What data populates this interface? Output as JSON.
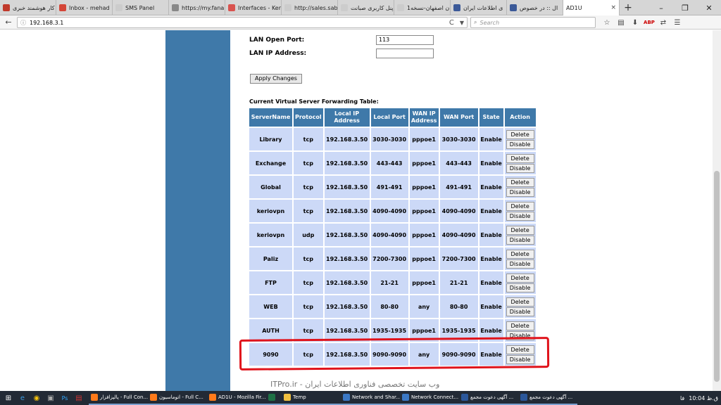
{
  "browser": {
    "tabs": [
      {
        "label": "کار هوشمند خبری",
        "icon_color": "#c0392b"
      },
      {
        "label": "Inbox - mehad",
        "icon_color": "#d44638"
      },
      {
        "label": "SMS Panel",
        "icon_color": "#cccccc"
      },
      {
        "label": "https://my.fana",
        "icon_color": "#888888"
      },
      {
        "label": "Interfaces - Ker",
        "icon_color": "#d9534f"
      },
      {
        "label": "http://sales.saban",
        "icon_color": "#cccccc"
      },
      {
        "label": "پنل کاربری صبانت",
        "icon_color": "#cccccc"
      },
      {
        "label": "ستان اصفهان-نسخه1",
        "icon_color": "#cccccc"
      },
      {
        "label": "ی اطلاعات ایران",
        "icon_color": "#3b5998"
      },
      {
        "label": "ال :: در خصوص",
        "icon_color": "#3b5998"
      }
    ],
    "active_tab": {
      "label": "AD1U",
      "close": "×"
    },
    "new_tab": "+",
    "window_controls": [
      "–",
      "❐",
      "✕"
    ],
    "url": "192.168.3.1",
    "search_placeholder": "Search",
    "back_icon": "←",
    "info_icon": "ⓘ",
    "reload_icon": "C",
    "dropdown_icon": "▼",
    "nav_icons": [
      "☆",
      "▤",
      "⬇",
      "ABP",
      "⇄",
      "☰"
    ]
  },
  "form": {
    "lan_open_port_label": "LAN Open Port:",
    "lan_open_port_value": "113",
    "lan_ip_label": "LAN IP Address:",
    "lan_ip_value": "",
    "apply_button": "Apply Changes"
  },
  "table": {
    "title": "Current Virtual Server Forwarding Table:",
    "headers": [
      "ServerName",
      "Protocol",
      "Local IP Address",
      "Local Port",
      "WAN IP Address",
      "WAN Port",
      "State",
      "Action"
    ],
    "delete_label": "Delete",
    "disable_label": "Disable",
    "rows": [
      {
        "name": "Library",
        "protocol": "tcp",
        "local_ip": "192.168.3.50",
        "local_port": "3030-3030",
        "wan_ip": "pppoe1",
        "wan_port": "3030-3030",
        "state": "Enable"
      },
      {
        "name": "Exchange",
        "protocol": "tcp",
        "local_ip": "192.168.3.50",
        "local_port": "443-443",
        "wan_ip": "pppoe1",
        "wan_port": "443-443",
        "state": "Enable"
      },
      {
        "name": "Global",
        "protocol": "tcp",
        "local_ip": "192.168.3.50",
        "local_port": "491-491",
        "wan_ip": "pppoe1",
        "wan_port": "491-491",
        "state": "Enable"
      },
      {
        "name": "keriovpn",
        "protocol": "tcp",
        "local_ip": "192.168.3.50",
        "local_port": "4090-4090",
        "wan_ip": "pppoe1",
        "wan_port": "4090-4090",
        "state": "Enable"
      },
      {
        "name": "keriovpn",
        "protocol": "udp",
        "local_ip": "192.168.3.50",
        "local_port": "4090-4090",
        "wan_ip": "pppoe1",
        "wan_port": "4090-4090",
        "state": "Enable"
      },
      {
        "name": "Paliz",
        "protocol": "tcp",
        "local_ip": "192.168.3.50",
        "local_port": "7200-7300",
        "wan_ip": "pppoe1",
        "wan_port": "7200-7300",
        "state": "Enable"
      },
      {
        "name": "FTP",
        "protocol": "tcp",
        "local_ip": "192.168.3.50",
        "local_port": "21-21",
        "wan_ip": "pppoe1",
        "wan_port": "21-21",
        "state": "Enable"
      },
      {
        "name": "WEB",
        "protocol": "tcp",
        "local_ip": "192.168.3.50",
        "local_port": "80-80",
        "wan_ip": "any",
        "wan_port": "80-80",
        "state": "Enable"
      },
      {
        "name": "AUTH",
        "protocol": "tcp",
        "local_ip": "192.168.3.50",
        "local_port": "1935-1935",
        "wan_ip": "pppoe1",
        "wan_port": "1935-1935",
        "state": "Enable"
      },
      {
        "name": "9090",
        "protocol": "tcp",
        "local_ip": "192.168.3.50",
        "local_port": "9090-9090",
        "wan_ip": "any",
        "wan_port": "9090-9090",
        "state": "Enable"
      }
    ]
  },
  "highlight_color": "#e0131b",
  "watermark": "ITPro.ir - وب سایت تخصصی فناوری اطلاعات ایران",
  "taskbar": {
    "start_icon": "⊞",
    "pinned_icons": [
      "e",
      "◉",
      "▣",
      "Ps",
      "▤"
    ],
    "tasks": [
      {
        "label": "پالپزافزار - Full Con...",
        "color": "#ff7a1a"
      },
      {
        "label": "اتوماسیون - Full C...",
        "color": "#ff7a1a"
      },
      {
        "label": "AD1U - Mozilla Fir...",
        "color": "#ff7a1a"
      },
      {
        "label": "",
        "color": "#1e7145"
      },
      {
        "label": "Temp",
        "color": "#f0c040"
      },
      {
        "label": "Network and Shar...",
        "color": "#3b78c4"
      },
      {
        "label": "Network Connect...",
        "color": "#3b78c4"
      },
      {
        "label": "آگهی دعوت مجمع ...",
        "color": "#2b579a"
      },
      {
        "label": "آگهی دعوت مجمع ...",
        "color": "#2b579a"
      }
    ],
    "tray": {
      "lang": "فا",
      "time": "10:04 ق.ظ"
    }
  }
}
